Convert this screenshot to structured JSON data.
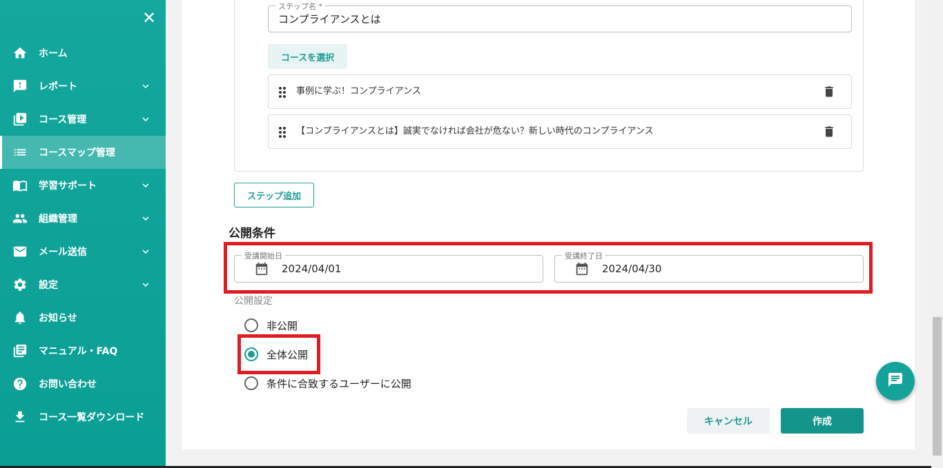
{
  "sidebar": {
    "items": [
      {
        "label": "ホーム"
      },
      {
        "label": "レポート"
      },
      {
        "label": "コース管理"
      },
      {
        "label": "コースマップ管理"
      },
      {
        "label": "学習サポート"
      },
      {
        "label": "組織管理"
      },
      {
        "label": "メール送信"
      },
      {
        "label": "設定"
      },
      {
        "label": "お知らせ"
      },
      {
        "label": "マニュアル・FAQ"
      },
      {
        "label": "お問い合わせ"
      },
      {
        "label": "コース一覧ダウンロード"
      }
    ],
    "active_item": "コースマップ管理"
  },
  "step": {
    "name_legend": "ステップ名 *",
    "name_value": "コンプライアンスとは",
    "select_course_label": "コースを選択",
    "courses": [
      {
        "title": "事例に学ぶ！コンプライアンス"
      },
      {
        "title": "【コンプライアンスとは】誠実でなければ会社が危ない？新しい時代のコンプライアンス"
      }
    ],
    "add_step_label": "ステップ追加"
  },
  "publish": {
    "title": "公開条件",
    "start_legend": "受講開始日",
    "start_value": "2024/04/01",
    "end_legend": "受講終了日",
    "end_value": "2024/04/30",
    "visibility_label": "公開設定",
    "options": [
      {
        "label": "非公開",
        "checked": false
      },
      {
        "label": "全体公開",
        "checked": true
      },
      {
        "label": "条件に合致するユーザーに公開",
        "checked": false
      }
    ]
  },
  "actions": {
    "cancel_label": "キャンセル",
    "create_label": "作成"
  },
  "colors": {
    "accent": "#1e9d94",
    "sidebar": "#0aa39a",
    "highlight": "#e01b24"
  }
}
